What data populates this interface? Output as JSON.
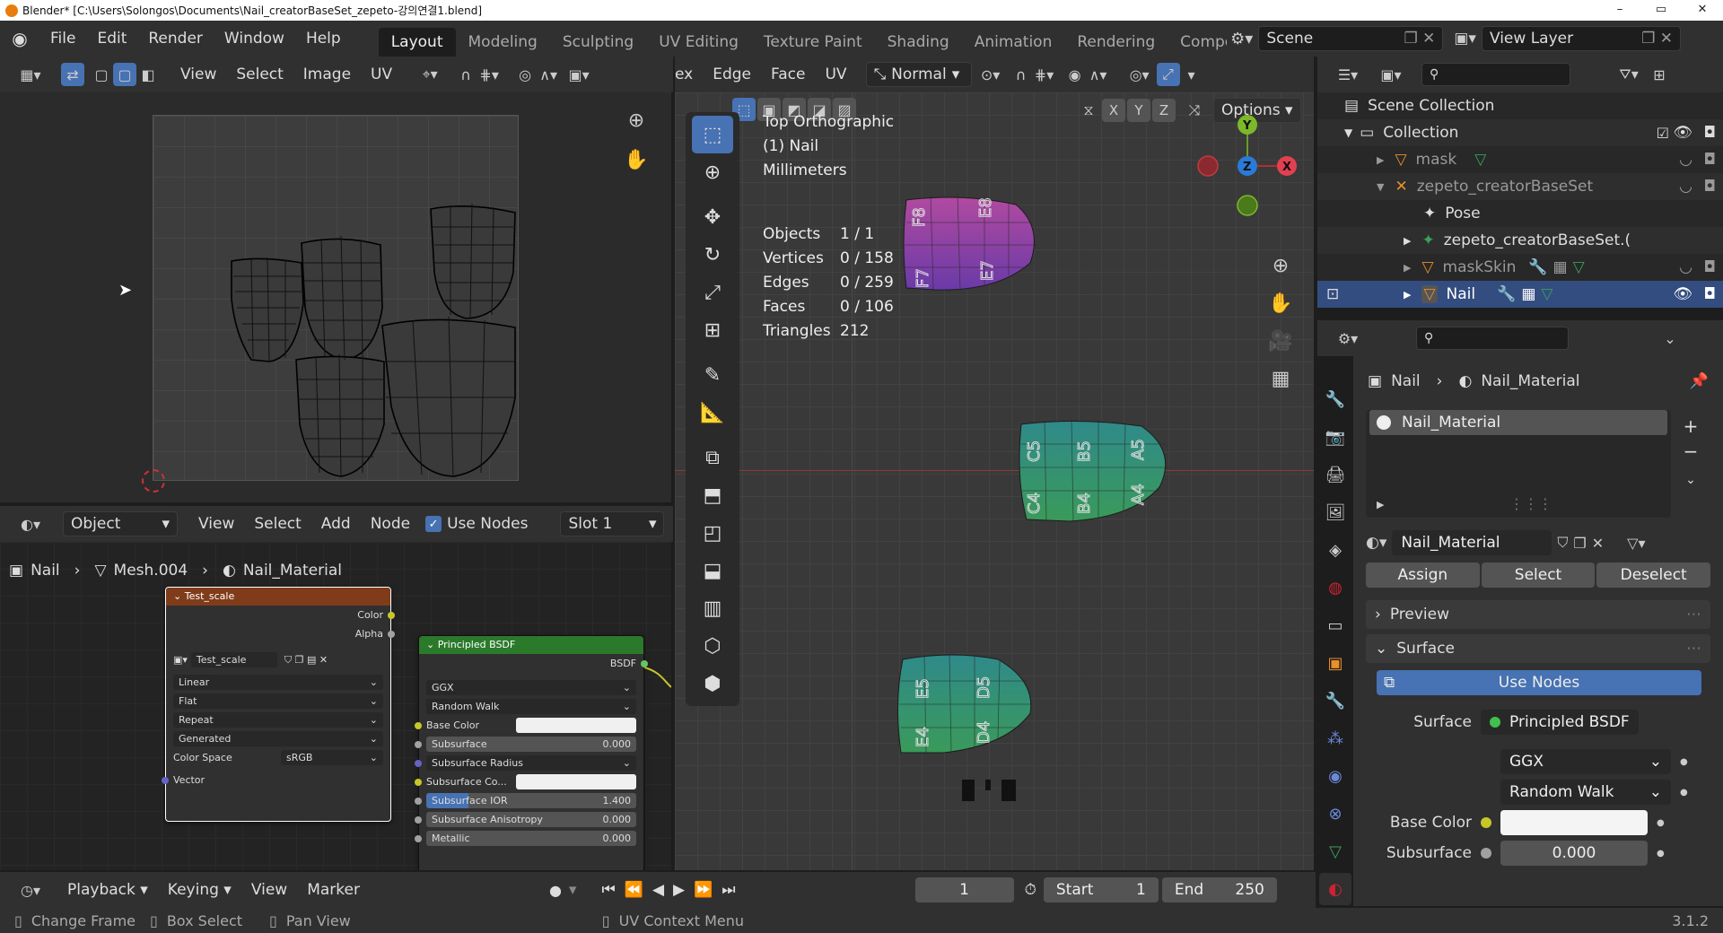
{
  "window": {
    "title": "Blender* [C:\\Users\\Solongos\\Documents\\Nail_creatorBaseSet_zepeto-강의연결1.blend]",
    "minimize": "–",
    "maximize": "▭",
    "close": "✕"
  },
  "menus": [
    "File",
    "Edit",
    "Render",
    "Window",
    "Help"
  ],
  "workspaces": [
    "Layout",
    "Modeling",
    "Sculpting",
    "UV Editing",
    "Texture Paint",
    "Shading",
    "Animation",
    "Rendering",
    "Compo"
  ],
  "scene": {
    "name": "Scene",
    "view_layer": "View Layer"
  },
  "uv_editor": {
    "header": [
      "View",
      "Select",
      "Image",
      "UV"
    ]
  },
  "node_editor": {
    "object_mode": "Object",
    "menus": [
      "View",
      "Select",
      "Add",
      "Node"
    ],
    "use_nodes": "Use Nodes",
    "slot": "Slot 1",
    "breadcrumb": [
      "Nail",
      "Mesh.004",
      "Nail_Material"
    ],
    "image_node": {
      "title": "Test_scale",
      "out_color": "Color",
      "out_alpha": "Alpha",
      "image": "Test_scale",
      "interp": "Linear",
      "proj": "Flat",
      "ext": "Repeat",
      "source": "Generated",
      "cs_label": "Color Space",
      "cs": "sRGB",
      "vector": "Vector"
    },
    "bsdf_node": {
      "title": "Principled BSDF",
      "out": "BSDF",
      "dist": "GGX",
      "sss": "Random Walk",
      "base_color": "Base Color",
      "subsurface": "Subsurface",
      "subsurface_val": "0.000",
      "ss_radius": "Subsurface Radius",
      "ss_color": "Subsurface Co...",
      "ss_ior": "Subsurface IOR",
      "ss_ior_val": "1.400",
      "ss_aniso": "Subsurface Anisotropy",
      "ss_aniso_val": "0.000",
      "metallic": "Metallic",
      "metallic_val": "0.000"
    }
  },
  "viewport": {
    "menus": [
      "ex",
      "Edge",
      "Face",
      "UV"
    ],
    "orientation": "Normal",
    "options": "Options",
    "view_name": "Top Orthographic",
    "object": "(1) Nail",
    "units": "Millimeters",
    "stats": [
      [
        "Objects",
        "1 / 1"
      ],
      [
        "Vertices",
        "0 / 158"
      ],
      [
        "Edges",
        "0 / 259"
      ],
      [
        "Faces",
        "0 / 106"
      ],
      [
        "Triangles",
        "212"
      ]
    ],
    "axes": {
      "x": "X",
      "y": "Y",
      "z": "Z"
    },
    "nail_labels": {
      "a": [
        "F8",
        "E8",
        "F7",
        "E7"
      ],
      "b": [
        "C5",
        "B5",
        "A5",
        "C4",
        "B4",
        "A4"
      ],
      "c": [
        "E5",
        "D5",
        "E4",
        "D4"
      ]
    }
  },
  "outliner": {
    "rows": [
      {
        "label": "Scene Collection",
        "indent": 0
      },
      {
        "label": "Collection",
        "indent": 1
      },
      {
        "label": "mask",
        "indent": 2
      },
      {
        "label": "zepeto_creatorBaseSet",
        "indent": 2
      },
      {
        "label": "Pose",
        "indent": 3
      },
      {
        "label": "zepeto_creatorBaseSet.(",
        "indent": 3
      },
      {
        "label": "maskSkin",
        "indent": 2
      },
      {
        "label": "Nail",
        "indent": 2
      }
    ]
  },
  "properties": {
    "breadcrumb_obj": "Nail",
    "breadcrumb_mat": "Nail_Material",
    "slot_item": "Nail_Material",
    "material_name": "Nail_Material",
    "assign": "Assign",
    "select": "Select",
    "deselect": "Deselect",
    "preview": "Preview",
    "surface_panel": "Surface",
    "use_nodes": "Use Nodes",
    "surface_label": "Surface",
    "surface_value": "Principled BSDF",
    "dist": "GGX",
    "sss": "Random Walk",
    "base_color": "Base Color",
    "subsurface": "Subsurface",
    "subsurface_val": "0.000"
  },
  "timeline": {
    "menus": [
      "Playback",
      "Keying",
      "View",
      "Marker"
    ],
    "frame": "1",
    "start_label": "Start",
    "start": "1",
    "end_label": "End",
    "end": "250"
  },
  "status": {
    "change_frame": "Change Frame",
    "box_select": "Box Select",
    "pan_view": "Pan View",
    "uv_context": "UV Context Menu",
    "version": "3.1.2"
  },
  "colors": {
    "accent": "#4772b3",
    "node_tex_header": "#803c1a",
    "node_shader_header": "#2b7a2b",
    "selected_row": "#334d80"
  }
}
